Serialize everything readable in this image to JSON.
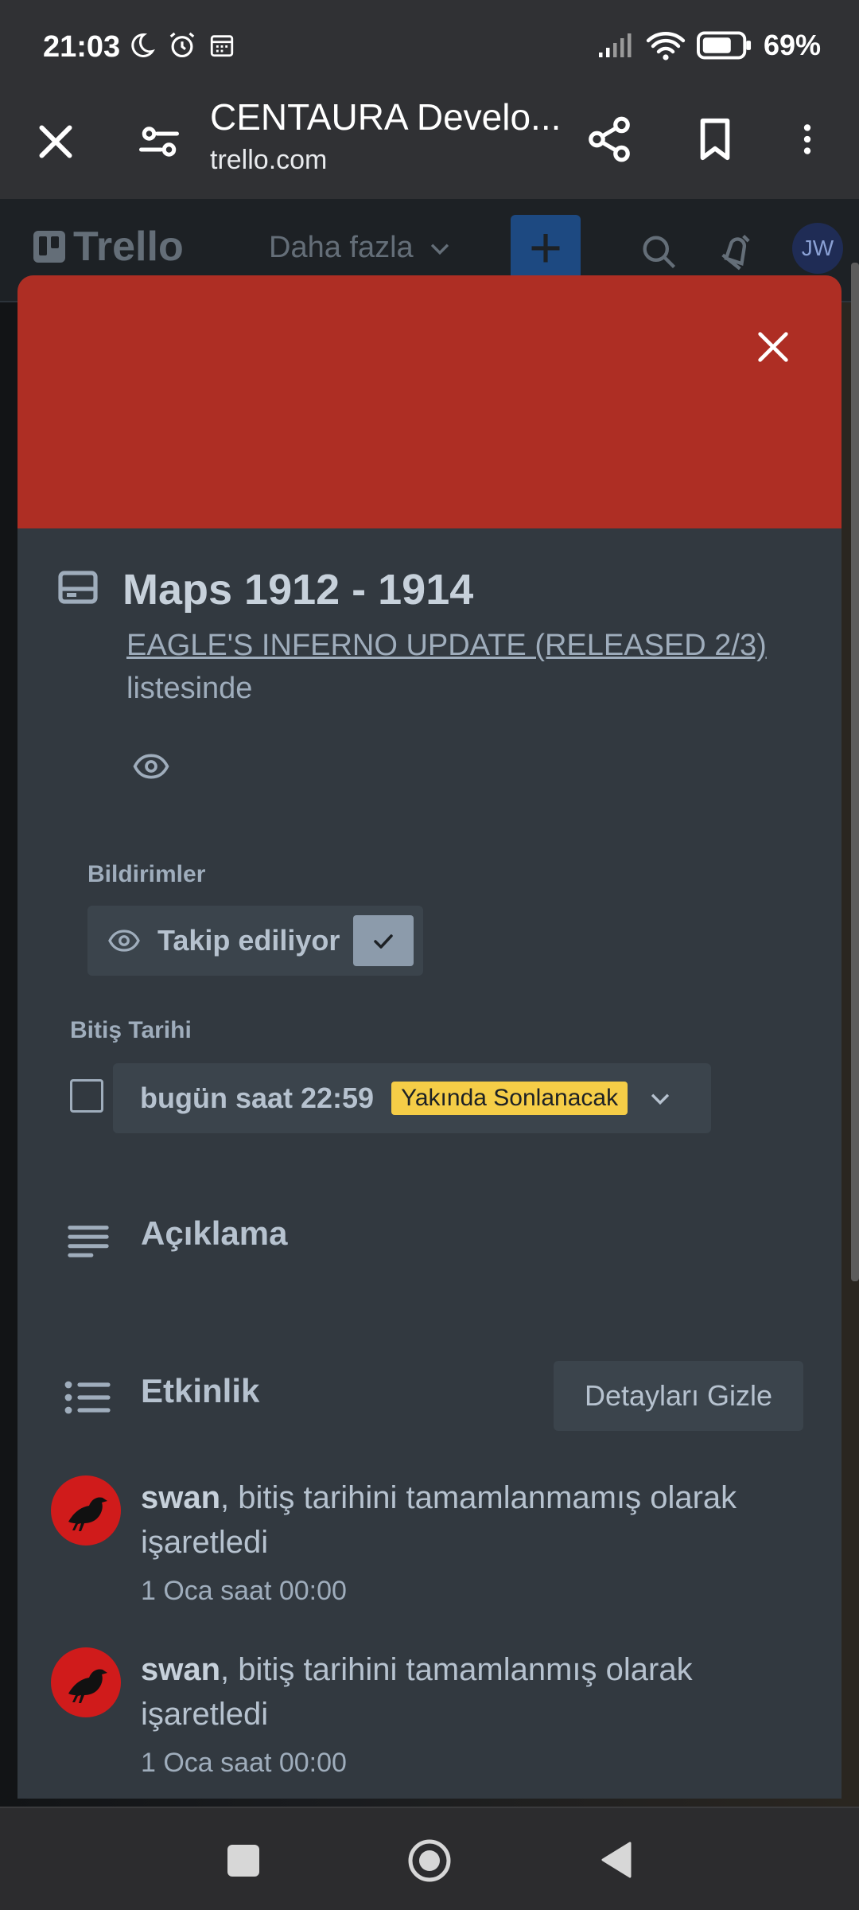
{
  "status_bar": {
    "time": "21:03",
    "battery": "69%",
    "icons": [
      "moon-icon",
      "alarm-icon",
      "calendar-icon",
      "signal-icon",
      "wifi-icon",
      "battery-icon"
    ]
  },
  "browser": {
    "title": "CENTAURA Develo...",
    "url": "trello.com"
  },
  "trello_header": {
    "logo": "Trello",
    "more_menu": "Daha fazla",
    "avatar_initials": "JW"
  },
  "card": {
    "cover_color": "#ae2e24",
    "title": "Maps 1912 - 1914",
    "list_name": "EAGLE'S INFERNO UPDATE (RELEASED 2/3)",
    "list_suffix": "listesinde",
    "notifications_label": "Bildirimler",
    "follow_label": "Takip ediliyor",
    "due_label": "Bitiş Tarihi",
    "due_date": "bugün saat 22:59",
    "due_badge": "Yakında Sonlanacak",
    "due_badge_color": "#f5cd47",
    "description_title": "Açıklama",
    "activity_title": "Etkinlik",
    "hide_details_label": "Detayları Gizle",
    "activity": [
      {
        "user": "swan",
        "action": ", bitiş tarihini tamamlanmamış olarak işaretledi",
        "time": "1 Oca saat 00:00"
      },
      {
        "user": "swan",
        "action": ", bitiş tarihini tamamlanmış olarak işaretledi",
        "time": "1 Oca saat 00:00"
      }
    ]
  }
}
